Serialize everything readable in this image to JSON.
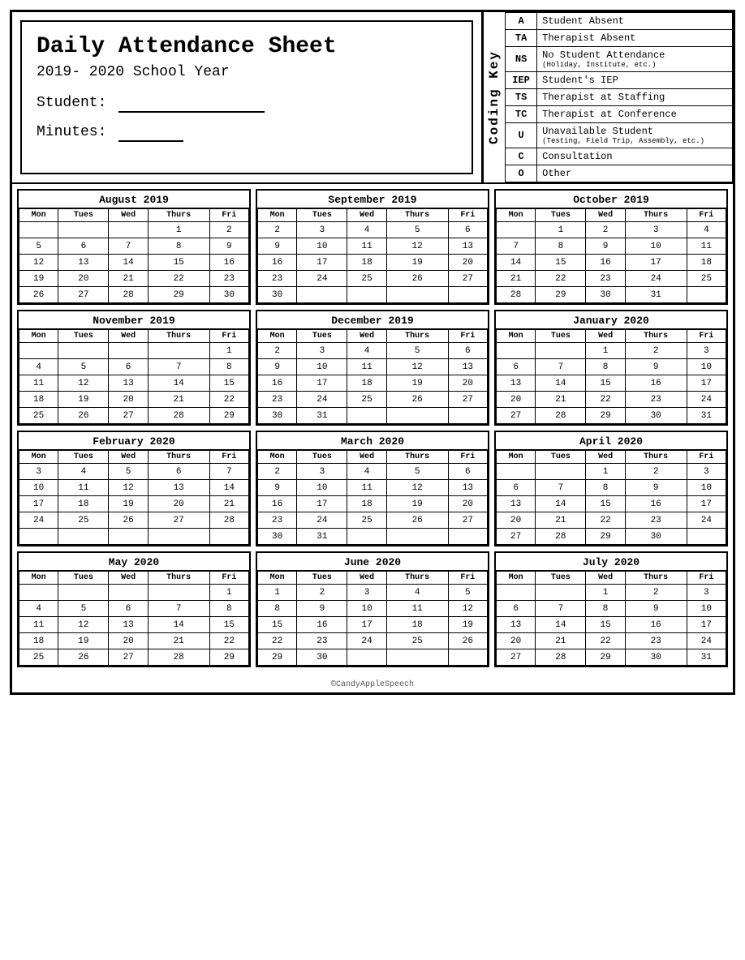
{
  "header": {
    "title": "Daily Attendance Sheet",
    "subtitle": "2019- 2020 School Year",
    "student_label": "Student:",
    "minutes_label": "Minutes:"
  },
  "coding_key": {
    "label": "Coding Key",
    "items": [
      {
        "code": "A",
        "desc": "Student Absent",
        "sub": ""
      },
      {
        "code": "TA",
        "desc": "Therapist Absent",
        "sub": ""
      },
      {
        "code": "NS",
        "desc": "No Student Attendance",
        "sub": "(Holiday, Institute, etc.)"
      },
      {
        "code": "IEP",
        "desc": "Student's IEP",
        "sub": ""
      },
      {
        "code": "TS",
        "desc": "Therapist at Staffing",
        "sub": ""
      },
      {
        "code": "TC",
        "desc": "Therapist at Conference",
        "sub": ""
      },
      {
        "code": "U",
        "desc": "Unavailable Student",
        "sub": "(Testing, Field Trip, Assembly, etc.)"
      },
      {
        "code": "C",
        "desc": "Consultation",
        "sub": ""
      },
      {
        "code": "O",
        "desc": "Other",
        "sub": ""
      }
    ]
  },
  "calendars": [
    {
      "month": "August 2019",
      "days": [
        "Mon",
        "Tues",
        "Wed",
        "Thurs",
        "Fri"
      ],
      "weeks": [
        [
          "",
          "",
          "",
          "1",
          "2"
        ],
        [
          "5",
          "6",
          "7",
          "8",
          "9"
        ],
        [
          "12",
          "13",
          "14",
          "15",
          "16"
        ],
        [
          "19",
          "20",
          "21",
          "22",
          "23"
        ],
        [
          "26",
          "27",
          "28",
          "29",
          "30"
        ]
      ]
    },
    {
      "month": "September 2019",
      "days": [
        "Mon",
        "Tues",
        "Wed",
        "Thurs",
        "Fri"
      ],
      "weeks": [
        [
          "2",
          "3",
          "4",
          "5",
          "6"
        ],
        [
          "9",
          "10",
          "11",
          "12",
          "13"
        ],
        [
          "16",
          "17",
          "18",
          "19",
          "20"
        ],
        [
          "23",
          "24",
          "25",
          "26",
          "27"
        ],
        [
          "30",
          "",
          "",
          "",
          ""
        ]
      ]
    },
    {
      "month": "October 2019",
      "days": [
        "Mon",
        "Tues",
        "Wed",
        "Thurs",
        "Fri"
      ],
      "weeks": [
        [
          "",
          "1",
          "2",
          "3",
          "4"
        ],
        [
          "7",
          "8",
          "9",
          "10",
          "11"
        ],
        [
          "14",
          "15",
          "16",
          "17",
          "18"
        ],
        [
          "21",
          "22",
          "23",
          "24",
          "25"
        ],
        [
          "28",
          "29",
          "30",
          "31",
          ""
        ]
      ]
    },
    {
      "month": "November 2019",
      "days": [
        "Mon",
        "Tues",
        "Wed",
        "Thurs",
        "Fri"
      ],
      "weeks": [
        [
          "",
          "",
          "",
          "",
          "1"
        ],
        [
          "4",
          "5",
          "6",
          "7",
          "8"
        ],
        [
          "11",
          "12",
          "13",
          "14",
          "15"
        ],
        [
          "18",
          "19",
          "20",
          "21",
          "22"
        ],
        [
          "25",
          "26",
          "27",
          "28",
          "29"
        ]
      ]
    },
    {
      "month": "December 2019",
      "days": [
        "Mon",
        "Tues",
        "Wed",
        "Thurs",
        "Fri"
      ],
      "weeks": [
        [
          "2",
          "3",
          "4",
          "5",
          "6"
        ],
        [
          "9",
          "10",
          "11",
          "12",
          "13"
        ],
        [
          "16",
          "17",
          "18",
          "19",
          "20"
        ],
        [
          "23",
          "24",
          "25",
          "26",
          "27"
        ],
        [
          "30",
          "31",
          "",
          "",
          ""
        ]
      ]
    },
    {
      "month": "January 2020",
      "days": [
        "Mon",
        "Tues",
        "Wed",
        "Thurs",
        "Fri"
      ],
      "weeks": [
        [
          "",
          "",
          "1",
          "2",
          "3"
        ],
        [
          "6",
          "7",
          "8",
          "9",
          "10"
        ],
        [
          "13",
          "14",
          "15",
          "16",
          "17"
        ],
        [
          "20",
          "21",
          "22",
          "23",
          "24"
        ],
        [
          "27",
          "28",
          "29",
          "30",
          "31"
        ]
      ]
    },
    {
      "month": "February 2020",
      "days": [
        "Mon",
        "Tues",
        "Wed",
        "Thurs",
        "Fri"
      ],
      "weeks": [
        [
          "3",
          "4",
          "5",
          "6",
          "7"
        ],
        [
          "10",
          "11",
          "12",
          "13",
          "14"
        ],
        [
          "17",
          "18",
          "19",
          "20",
          "21"
        ],
        [
          "24",
          "25",
          "26",
          "27",
          "28"
        ],
        [
          "",
          "",
          "",
          "",
          ""
        ]
      ]
    },
    {
      "month": "March 2020",
      "days": [
        "Mon",
        "Tues",
        "Wed",
        "Thurs",
        "Fri"
      ],
      "weeks": [
        [
          "2",
          "3",
          "4",
          "5",
          "6"
        ],
        [
          "9",
          "10",
          "11",
          "12",
          "13"
        ],
        [
          "16",
          "17",
          "18",
          "19",
          "20"
        ],
        [
          "23",
          "24",
          "25",
          "26",
          "27"
        ],
        [
          "30",
          "31",
          "",
          "",
          ""
        ]
      ]
    },
    {
      "month": "April 2020",
      "days": [
        "Mon",
        "Tues",
        "Wed",
        "Thurs",
        "Fri"
      ],
      "weeks": [
        [
          "",
          "",
          "1",
          "2",
          "3"
        ],
        [
          "6",
          "7",
          "8",
          "9",
          "10"
        ],
        [
          "13",
          "14",
          "15",
          "16",
          "17"
        ],
        [
          "20",
          "21",
          "22",
          "23",
          "24"
        ],
        [
          "27",
          "28",
          "29",
          "30",
          ""
        ]
      ]
    },
    {
      "month": "May 2020",
      "days": [
        "Mon",
        "Tues",
        "Wed",
        "Thurs",
        "Fri"
      ],
      "weeks": [
        [
          "",
          "",
          "",
          "",
          "1"
        ],
        [
          "4",
          "5",
          "6",
          "7",
          "8"
        ],
        [
          "11",
          "12",
          "13",
          "14",
          "15"
        ],
        [
          "18",
          "19",
          "20",
          "21",
          "22"
        ],
        [
          "25",
          "26",
          "27",
          "28",
          "29"
        ]
      ]
    },
    {
      "month": "June 2020",
      "days": [
        "Mon",
        "Tues",
        "Wed",
        "Thurs",
        "Fri"
      ],
      "weeks": [
        [
          "1",
          "2",
          "3",
          "4",
          "5"
        ],
        [
          "8",
          "9",
          "10",
          "11",
          "12"
        ],
        [
          "15",
          "16",
          "17",
          "18",
          "19"
        ],
        [
          "22",
          "23",
          "24",
          "25",
          "26"
        ],
        [
          "29",
          "30",
          "",
          "",
          ""
        ]
      ]
    },
    {
      "month": "July 2020",
      "days": [
        "Mon",
        "Tues",
        "Wed",
        "Thurs",
        "Fri"
      ],
      "weeks": [
        [
          "",
          "",
          "1",
          "2",
          "3"
        ],
        [
          "6",
          "7",
          "8",
          "9",
          "10"
        ],
        [
          "13",
          "14",
          "15",
          "16",
          "17"
        ],
        [
          "20",
          "21",
          "22",
          "23",
          "24"
        ],
        [
          "27",
          "28",
          "29",
          "30",
          "31"
        ]
      ]
    }
  ],
  "footer": "©CandyAppleSpeech"
}
